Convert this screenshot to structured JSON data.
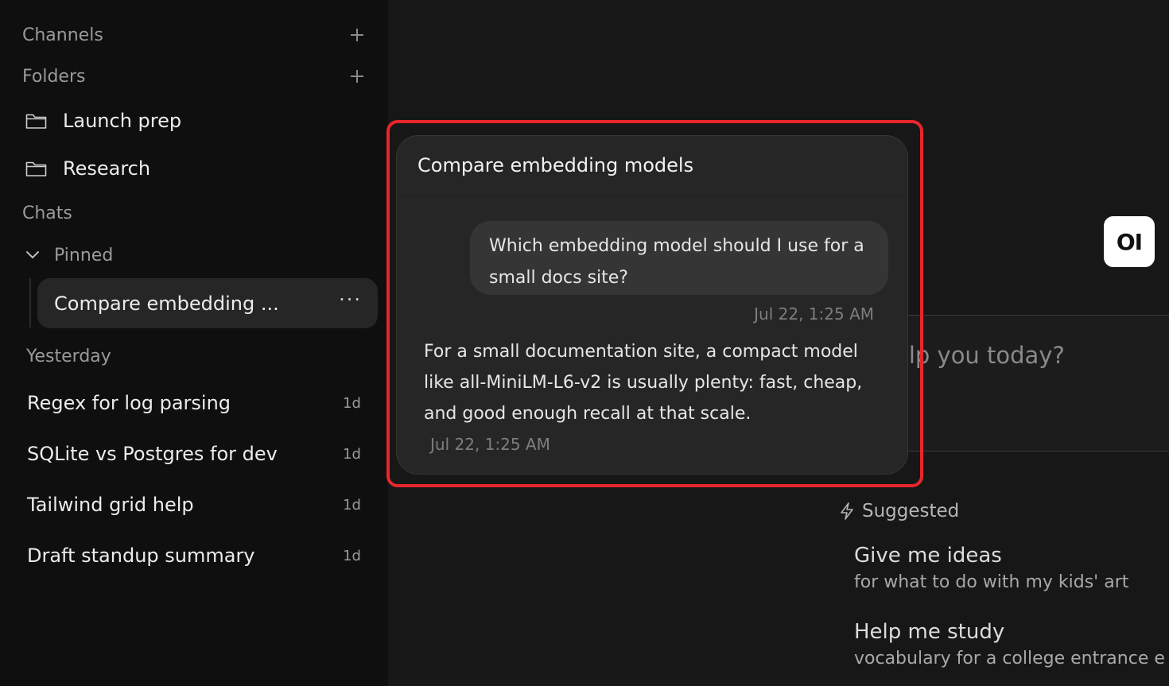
{
  "sidebar": {
    "channels_label": "Channels",
    "folders_label": "Folders",
    "folders": [
      {
        "label": "Launch prep",
        "icon": "folder-icon"
      },
      {
        "label": "Research",
        "icon": "folder-icon"
      }
    ],
    "chats_label": "Chats",
    "pinned_label": "Pinned",
    "pinned_chat": {
      "label": "Compare embedding ...",
      "menu": "···"
    },
    "group_label": "Yesterday",
    "chats": [
      {
        "title": "Regex for log parsing",
        "age": "1d"
      },
      {
        "title": "SQLite vs Postgres for dev",
        "age": "1d"
      },
      {
        "title": "Tailwind grid help",
        "age": "1d"
      },
      {
        "title": "Draft standup summary",
        "age": "1d"
      }
    ]
  },
  "main": {
    "logo_text": "OI",
    "prompt_placeholder_visible": "elp you today?",
    "suggested_label": "Suggested",
    "suggestions": [
      {
        "title": "Give me ideas",
        "subtitle": "for what to do with my kids' art"
      },
      {
        "title": "Help me study",
        "subtitle": "vocabulary for a college entrance e"
      }
    ]
  },
  "preview": {
    "title": "Compare embedding models",
    "user_message": "Which embedding model should I use for a small docs site?",
    "user_time": "Jul 22, 1:25 AM",
    "assistant_message": "For a small documentation site, a compact model like all-MiniLM-L6-v2 is usually plenty: fast, cheap, and good enough recall at that scale.",
    "assistant_time": "Jul 22, 1:25 AM"
  },
  "colors": {
    "sidebar_bg": "#0f0f0f",
    "main_bg": "#171717",
    "card_bg": "#262626",
    "highlight": "#e8262c"
  }
}
